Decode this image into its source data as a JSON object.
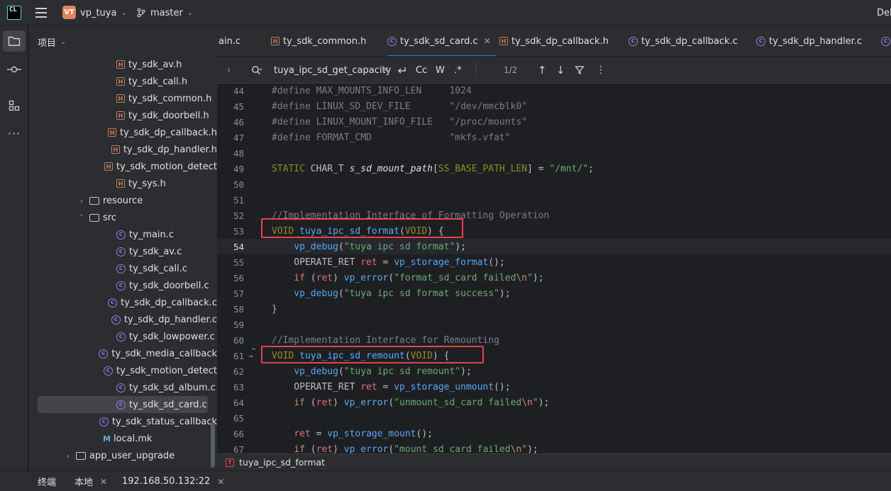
{
  "titlebar": {
    "app_logo": "CL",
    "project_badge": "VT",
    "project_name": "vp_tuya",
    "branch": "master",
    "right_text": "Del"
  },
  "project": {
    "header": "项目",
    "tree": [
      {
        "label": "ty_sdk_av.h",
        "type": "h",
        "indent": 164
      },
      {
        "label": "ty_sdk_call.h",
        "type": "h",
        "indent": 164
      },
      {
        "label": "ty_sdk_common.h",
        "type": "h",
        "indent": 164
      },
      {
        "label": "ty_sdk_doorbell.h",
        "type": "h",
        "indent": 164
      },
      {
        "label": "ty_sdk_dp_callback.h",
        "type": "h",
        "indent": 164
      },
      {
        "label": "ty_sdk_dp_handler.h",
        "type": "h",
        "indent": 164
      },
      {
        "label": "ty_sdk_motion_detect",
        "type": "h",
        "indent": 164
      },
      {
        "label": "ty_sys.h",
        "type": "h",
        "indent": 164
      },
      {
        "label": "resource",
        "type": "folder-closed",
        "indent": 126
      },
      {
        "label": "src",
        "type": "folder-open",
        "indent": 126
      },
      {
        "label": "ty_main.c",
        "type": "c",
        "indent": 164
      },
      {
        "label": "ty_sdk_av.c",
        "type": "c",
        "indent": 164
      },
      {
        "label": "ty_sdk_call.c",
        "type": "c",
        "indent": 164
      },
      {
        "label": "ty_sdk_doorbell.c",
        "type": "c",
        "indent": 164
      },
      {
        "label": "ty_sdk_dp_callback.c",
        "type": "c",
        "indent": 164
      },
      {
        "label": "ty_sdk_dp_handler.c",
        "type": "c",
        "indent": 164
      },
      {
        "label": "ty_sdk_lowpower.c",
        "type": "c",
        "indent": 164
      },
      {
        "label": "ty_sdk_media_callback",
        "type": "c",
        "indent": 164
      },
      {
        "label": "ty_sdk_motion_detect",
        "type": "c",
        "indent": 164
      },
      {
        "label": "ty_sdk_sd_album.c",
        "type": "c",
        "indent": 164
      },
      {
        "label": "ty_sdk_sd_card.c",
        "type": "c",
        "indent": 164,
        "selected": true
      },
      {
        "label": "ty_sdk_status_callback",
        "type": "c",
        "indent": 164
      },
      {
        "label": "local.mk",
        "type": "mk",
        "indent": 145
      },
      {
        "label": "app_user_upgrade",
        "type": "folder-closed",
        "indent": 107
      }
    ]
  },
  "tabs": [
    {
      "label": "ain.c",
      "icon": "c"
    },
    {
      "label": "ty_sdk_common.h",
      "icon": "h"
    },
    {
      "label": "ty_sdk_sd_card.c",
      "icon": "c",
      "active": true
    },
    {
      "label": "ty_sdk_dp_callback.h",
      "icon": "h"
    },
    {
      "label": "ty_sdk_dp_callback.c",
      "icon": "c"
    },
    {
      "label": "ty_sdk_dp_handler.c",
      "icon": "c"
    }
  ],
  "findbar": {
    "query": "tuya_ipc_sd_get_capacity",
    "match_case": "Cc",
    "words": "W",
    "regex": ".*",
    "result_count": "1/2"
  },
  "code": {
    "lines": [
      {
        "n": "44",
        "html": "<span class='cmt'>#define MAX_MOUNTS_INFO_LEN     1024</span>"
      },
      {
        "n": "45",
        "html": "<span class='cmt'>#define LINUX_SD_DEV_FILE       \"/dev/mmcblk0\"</span>"
      },
      {
        "n": "46",
        "html": "<span class='cmt'>#define LINUX_MOUNT_INFO_FILE   \"/proc/mounts\"</span>"
      },
      {
        "n": "47",
        "html": "<span class='cmt'>#define FORMAT_CMD              \"mkfs.vfat\"</span>"
      },
      {
        "n": "48",
        "html": ""
      },
      {
        "n": "49",
        "html": "<span class='mac'>STATIC</span> CHAR_T <span class='ital'>s_sd_mount_path</span>[<span class='mac'>SS_BASE_PATH_LEN</span>] = <span class='str'>\"/mnt/\"</span>;"
      },
      {
        "n": "50",
        "html": ""
      },
      {
        "n": "51",
        "html": ""
      },
      {
        "n": "52",
        "html": "<span class='cmt'>//Implementation Interface of Formatting Operation</span>"
      },
      {
        "n": "53",
        "html": "<span class='mac'>VOID</span> <span class='fn'>tuya_ipc_sd_format</span>(<span class='mac'>VOID</span>) {"
      },
      {
        "n": "54",
        "html": "    <span class='fncall'>vp_debug</span>(<span class='str'>\"tuya ipc sd format\"</span>);",
        "current": true
      },
      {
        "n": "55",
        "html": "    OPERATE_RET <span class='red'>ret</span> = <span class='fncall'>vp_storage_format</span>();"
      },
      {
        "n": "56",
        "html": "    <span class='kw'>if</span> (<span class='red'>ret</span>) <span class='fncall'>vp_error</span>(<span class='str'>\"format_sd_card failed</span><span class='esc'>\\n</span><span class='str'>\"</span>);"
      },
      {
        "n": "57",
        "html": "    <span class='fncall'>vp_debug</span>(<span class='str'>\"tuya ipc sd format success\"</span>);"
      },
      {
        "n": "58",
        "html": "}"
      },
      {
        "n": "59",
        "html": ""
      },
      {
        "n": "60",
        "html": "<span class='cmt'>//Implementation Interface for Remounting</span>"
      },
      {
        "n": "61",
        "html": "<span class='mac'>VOID</span> <span class='fn'>tuya_ipc_sd_remount</span>(<span class='mac'>VOID</span>) {",
        "gutter": true
      },
      {
        "n": "62",
        "html": "    <span class='fncall'>vp_debug</span>(<span class='str'>\"tuya ipc sd remount\"</span>);"
      },
      {
        "n": "63",
        "html": "    OPERATE_RET <span class='red'>ret</span> = <span class='fncall'>vp_storage_unmount</span>();"
      },
      {
        "n": "64",
        "html": "    <span class='kw'>if</span> (<span class='red'>ret</span>) <span class='fncall'>vp_error</span>(<span class='str'>\"unmount_sd_card failed</span><span class='esc'>\\n</span><span class='str'>\"</span>);"
      },
      {
        "n": "65",
        "html": ""
      },
      {
        "n": "66",
        "html": "    <span class='red'>ret</span> = <span class='fncall'>vp_storage_mount</span>();"
      },
      {
        "n": "67",
        "html": "    <span class='kw'>if</span> (<span class='red'>ret</span>) <span class='fncall'>vp_error</span>(<span class='str'>\"mount_sd_card failed</span><span class='esc'>\\n</span><span class='str'>\"</span>);"
      }
    ]
  },
  "breadcrumb": {
    "icon": "f",
    "label": "tuya_ipc_sd_format"
  },
  "terminal": {
    "title": "终端",
    "tabs": [
      "本地",
      "192.168.50.132:22"
    ]
  }
}
